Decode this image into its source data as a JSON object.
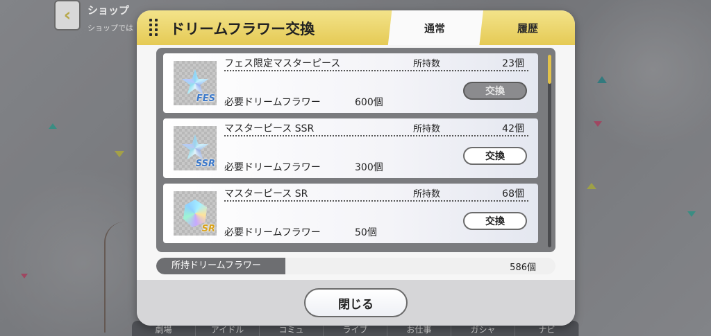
{
  "background": {
    "shop_title": "ショップ",
    "shop_subtitle": "ショップでは",
    "nav": [
      "劇場",
      "アイドル",
      "コミュ",
      "ライブ",
      "お仕事",
      "ガシャ",
      "ナビ"
    ]
  },
  "dialog": {
    "title": "ドリームフラワー交換",
    "tabs": [
      {
        "label": "通常",
        "active": true
      },
      {
        "label": "履歴",
        "active": false
      }
    ],
    "items": [
      {
        "name": "フェス限定マスターピース",
        "owned_label": "所持数",
        "owned_value": "23個",
        "required_label": "必要ドリームフラワー",
        "required_value": "600個",
        "button_label": "交換",
        "button_enabled": false,
        "icon": "fes-masterpiece-icon",
        "icon_tag": "FES"
      },
      {
        "name": "マスターピース SSR",
        "owned_label": "所持数",
        "owned_value": "42個",
        "required_label": "必要ドリームフラワー",
        "required_value": "300個",
        "button_label": "交換",
        "button_enabled": true,
        "icon": "ssr-masterpiece-icon",
        "icon_tag": "SSR"
      },
      {
        "name": "マスターピース SR",
        "owned_label": "所持数",
        "owned_value": "68個",
        "required_label": "必要ドリームフラワー",
        "required_value": "50個",
        "button_label": "交換",
        "button_enabled": true,
        "icon": "sr-masterpiece-icon",
        "icon_tag": "SR"
      }
    ],
    "owned_flowers_label": "所持ドリームフラワー",
    "owned_flowers_value": "586個",
    "close_label": "閉じる"
  },
  "colors": {
    "header_gold": "#e9cf5c",
    "scroll_thumb": "#e2c24a",
    "disabled_button": "#8b8b8e"
  }
}
